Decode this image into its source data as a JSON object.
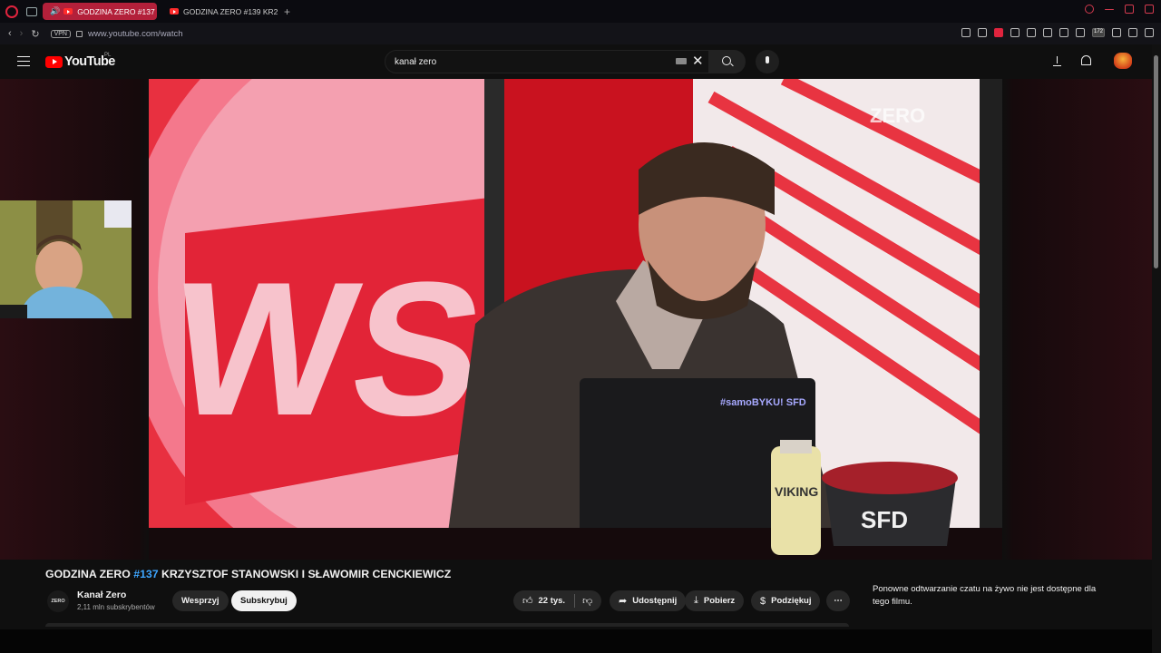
{
  "browser": {
    "tabs": [
      {
        "label": "GODZINA ZERO #137",
        "active": true
      },
      {
        "label": "GODZINA ZERO #139 KR2",
        "active": false
      }
    ],
    "vpn_label": "VPN",
    "url": "www.youtube.com/watch",
    "extension_badge": "172",
    "accent_color": "#e0243e"
  },
  "youtube": {
    "logo_text": "YouTube",
    "country_code": "PL",
    "search_value": "kanał zero",
    "video": {
      "title_prefix": "GODZINA ZERO ",
      "title_hashtag": "#137",
      "title_rest": " KRZYSZTOF STANOWSKI I SŁAWOMIR CENCKIEWICZ",
      "overlay_text": "ZERO",
      "studio_sign": "WSP",
      "laptop_sticker": "#samoBYKU! SFD",
      "bottle_label": "VIKING",
      "bowl_label": "SFD"
    },
    "channel": {
      "avatar_text": "ZERO",
      "name": "Kanał Zero",
      "subscribers": "2,11 mln subskrybentów"
    },
    "actions": {
      "support": "Wesprzyj",
      "subscribe": "Subskrybuj",
      "likes": "22 tys.",
      "share": "Udostępnij",
      "download": "Pobierz",
      "thanks": "Podziękuj",
      "more": "⋯"
    },
    "chat_note": "Ponowne odtwarzanie czatu na żywo nie jest dostępne dla tego filmu."
  }
}
